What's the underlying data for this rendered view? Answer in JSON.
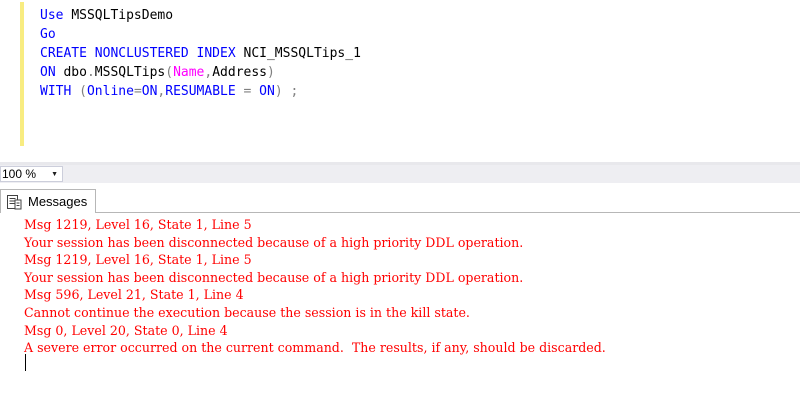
{
  "editor": {
    "lines": [
      {
        "parts": [
          {
            "text": "Use ",
            "c": "kw"
          },
          {
            "text": "MSSQLTipsDemo",
            "c": ""
          }
        ]
      },
      {
        "parts": [
          {
            "text": "Go",
            "c": "kw"
          }
        ]
      },
      {
        "parts": [
          {
            "text": "CREATE NONCLUSTERED INDEX ",
            "c": "kw"
          },
          {
            "text": "NCI_MSSQLTips_1",
            "c": ""
          }
        ]
      },
      {
        "parts": [
          {
            "text": "ON ",
            "c": "kw"
          },
          {
            "text": "dbo",
            "c": ""
          },
          {
            "text": ".",
            "c": "gr"
          },
          {
            "text": "MSSQLTips",
            "c": ""
          },
          {
            "text": "(",
            "c": "gr"
          },
          {
            "text": "Name",
            "c": "mg"
          },
          {
            "text": ",",
            "c": "gr"
          },
          {
            "text": "Address",
            "c": ""
          },
          {
            "text": ")",
            "c": "gr"
          }
        ]
      },
      {
        "parts": [
          {
            "text": "WITH ",
            "c": "kw"
          },
          {
            "text": "(",
            "c": "gr"
          },
          {
            "text": "Online",
            "c": "kw"
          },
          {
            "text": "=",
            "c": "gr"
          },
          {
            "text": "ON",
            "c": "kw"
          },
          {
            "text": ",",
            "c": "gr"
          },
          {
            "text": "RESUMABLE ",
            "c": "kw"
          },
          {
            "text": "=",
            "c": "gr"
          },
          {
            "text": " ON",
            "c": "kw"
          },
          {
            "text": ") ;",
            "c": "gr"
          }
        ]
      }
    ]
  },
  "zoom": {
    "value": "100 %"
  },
  "results": {
    "tab_label": "Messages",
    "messages": [
      "Msg 1219, Level 16, State 1, Line 5",
      "Your session has been disconnected because of a high priority DDL operation.",
      "Msg 1219, Level 16, State 1, Line 5",
      "Your session has been disconnected because of a high priority DDL operation.",
      "Msg 596, Level 21, State 1, Line 4",
      "Cannot continue the execution because the session is in the kill state.",
      "Msg 0, Level 20, State 0, Line 4",
      "A severe error occurred on the current command.  The results, if any, should be discarded."
    ]
  },
  "colors": {
    "keyword": "#0000ff",
    "operator": "#808080",
    "function": "#ff00ff",
    "error": "#ff0000",
    "margin_indicator": "#f8ec81"
  },
  "icons": {
    "messages_tab": "messages-icon",
    "zoom_dropdown": "chevron-down-icon"
  }
}
